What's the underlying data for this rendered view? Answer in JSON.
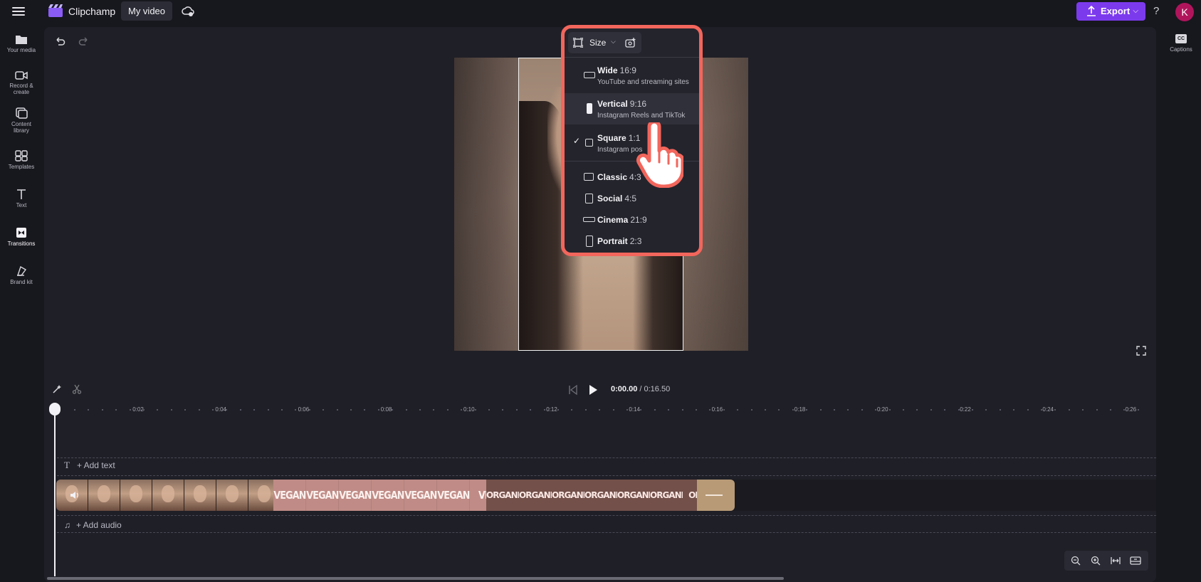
{
  "topbar": {
    "app_name": "Clipchamp",
    "video_tab": "My video",
    "export_label": "Export",
    "help_label": "?",
    "avatar_initial": "K"
  },
  "sidebar": {
    "items": [
      {
        "label": "Your media",
        "icon": "folder-icon"
      },
      {
        "label": "Record & create",
        "icon": "camera-icon"
      },
      {
        "label": "Content library",
        "icon": "library-icon"
      },
      {
        "label": "Templates",
        "icon": "templates-icon"
      },
      {
        "label": "Text",
        "icon": "text-icon"
      },
      {
        "label": "Transitions",
        "icon": "transitions-icon"
      },
      {
        "label": "Brand kit",
        "icon": "brand-kit-icon"
      }
    ]
  },
  "rightbar": {
    "captions_label": "Captions",
    "cc_glyph": "CC"
  },
  "size_menu": {
    "button_label": "Size",
    "options": [
      {
        "name": "Wide",
        "ratio": "16:9",
        "desc": "YouTube and streaming sites"
      },
      {
        "name": "Vertical",
        "ratio": "9:16",
        "desc": "Instagram Reels and TikTok"
      },
      {
        "name": "Square",
        "ratio": "1:1",
        "desc": "Instagram pos"
      },
      {
        "name": "Classic",
        "ratio": "4:3"
      },
      {
        "name": "Social",
        "ratio": "4:5"
      },
      {
        "name": "Cinema",
        "ratio": "21:9"
      },
      {
        "name": "Portrait",
        "ratio": "2:3"
      }
    ],
    "selected": "Square",
    "highlighted": "Vertical"
  },
  "playback": {
    "current_time": "0:00.00",
    "total_time": "/ 0:16.50"
  },
  "ruler": {
    "labels": [
      "0:02",
      "0:04",
      "0:06",
      "0:08",
      "0:10",
      "0:12",
      "0:14",
      "0:16",
      "0:18",
      "0:20",
      "0:22",
      "0:24",
      "0:26"
    ]
  },
  "timeline": {
    "add_text_label": "+ Add text",
    "text_glyph": "T",
    "add_audio_label": "+ Add audio",
    "audio_glyph": "♫",
    "clip_words": {
      "vegan": [
        "VEGAN",
        "VEGAN",
        "VEGAN",
        "VEGAN",
        "VEGAN",
        "VEGAN",
        "VE("
      ],
      "organic": [
        "ORGANIC",
        "ORGANIC",
        "ORGANIC",
        "ORGANIC",
        "ORGANIC",
        "ORGANIC",
        "ORG."
      ]
    }
  },
  "colors": {
    "accent": "#7c3aed",
    "highlight_border": "#f2665c",
    "avatar": "#b0155c"
  }
}
